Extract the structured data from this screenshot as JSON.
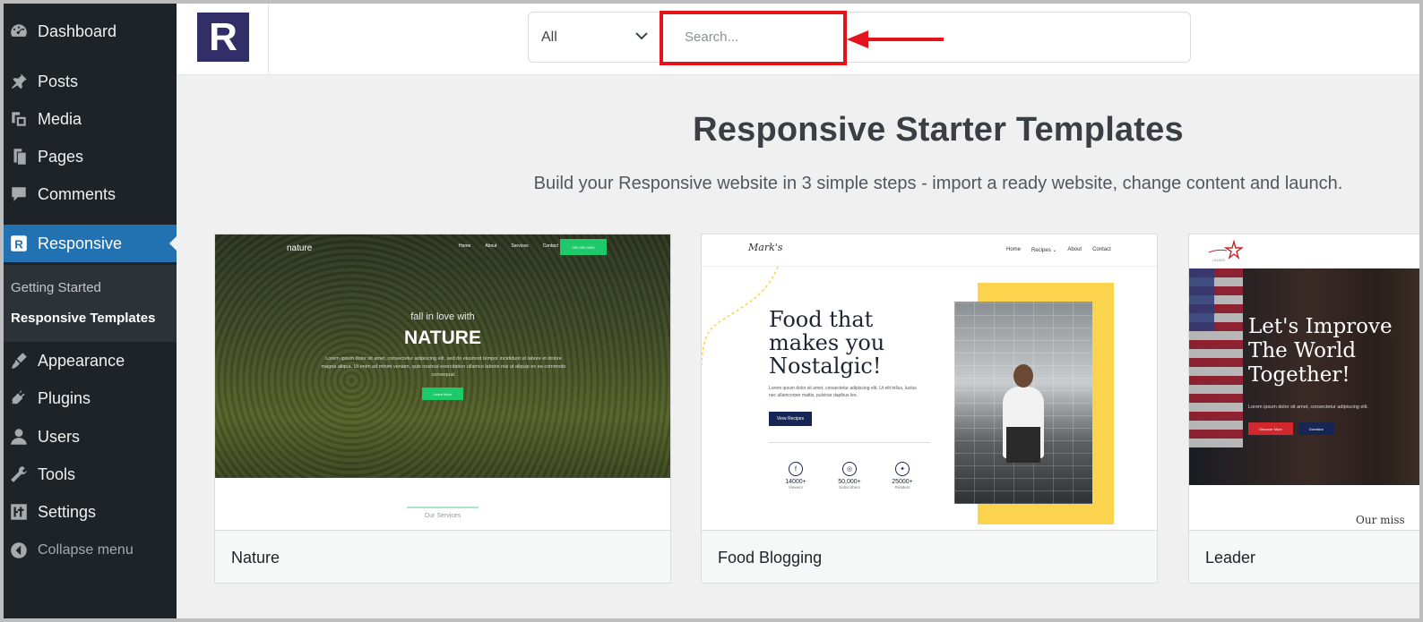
{
  "sidebar": {
    "items": [
      {
        "label": "Dashboard",
        "icon": "dashboard-icon"
      },
      {
        "label": "Posts",
        "icon": "pin-icon"
      },
      {
        "label": "Media",
        "icon": "media-icon"
      },
      {
        "label": "Pages",
        "icon": "pages-icon"
      },
      {
        "label": "Comments",
        "icon": "comments-icon"
      },
      {
        "label": "Responsive",
        "icon": "responsive-icon"
      },
      {
        "label": "Appearance",
        "icon": "appearance-icon"
      },
      {
        "label": "Plugins",
        "icon": "plugins-icon"
      },
      {
        "label": "Users",
        "icon": "users-icon"
      },
      {
        "label": "Tools",
        "icon": "tools-icon"
      },
      {
        "label": "Settings",
        "icon": "settings-icon"
      }
    ],
    "submenu": [
      "Getting Started",
      "Responsive Templates"
    ],
    "collapse_label": "Collapse menu",
    "active_color": "#2271b1",
    "background": "#1d2327"
  },
  "header": {
    "logo_letter": "R",
    "filter_value": "All",
    "search_placeholder": "Search...",
    "highlight_color": "#e3121b"
  },
  "main": {
    "title": "Responsive Starter Templates",
    "subtitle": "Build your Responsive website in 3 simple steps - import a ready website, change content and launch."
  },
  "templates": [
    {
      "name": "Nature",
      "preview": {
        "logo": "nature",
        "nav": [
          "Home",
          "About",
          "Services",
          "Contact"
        ],
        "nav_button": "000-000-0000",
        "tagline": "fall in love with",
        "heading": "NATURE",
        "paragraph": "Lorem ipsum dolor sit amet, consectetur adipiscing elit, sed do eiusmod tempor incididunt ut labore et dolore magna aliqua. Ut enim ad minim veniam, quis nostrud exercitation ullamco laboris nisi ut aliquip ex ea commodo consequat.",
        "cta": "Learn More",
        "section": "Our Services"
      }
    },
    {
      "name": "Food Blogging",
      "preview": {
        "logo": "Mark's",
        "nav": [
          "Home",
          "Recipes ⌄",
          "About",
          "Contact"
        ],
        "heading": "Food that makes you Nostalgic!",
        "paragraph": "Lorem ipsum dolor sit amet, consectetur adipiscing elit. Ut elit tellus, luctus nec ullamcorper mattis, pulvinar dapibus leo.",
        "cta": "View Recipes",
        "stats": [
          {
            "icon": "facebook-icon",
            "value": "14000+",
            "label": "Viewers"
          },
          {
            "icon": "instagram-icon",
            "value": "50,000+",
            "label": "Subscribers"
          },
          {
            "icon": "twitter-icon",
            "value": "25000+",
            "label": "Readers"
          }
        ]
      }
    },
    {
      "name": "Leader",
      "preview": {
        "logo": "LEADER",
        "heading": "Let's Improve The World Together!",
        "paragraph": "Lorem ipsum dolor sit amet, consectetur adipiscing elit.",
        "cta_primary": "Discover More",
        "cta_secondary": "Donation",
        "section": "Our miss"
      }
    }
  ]
}
